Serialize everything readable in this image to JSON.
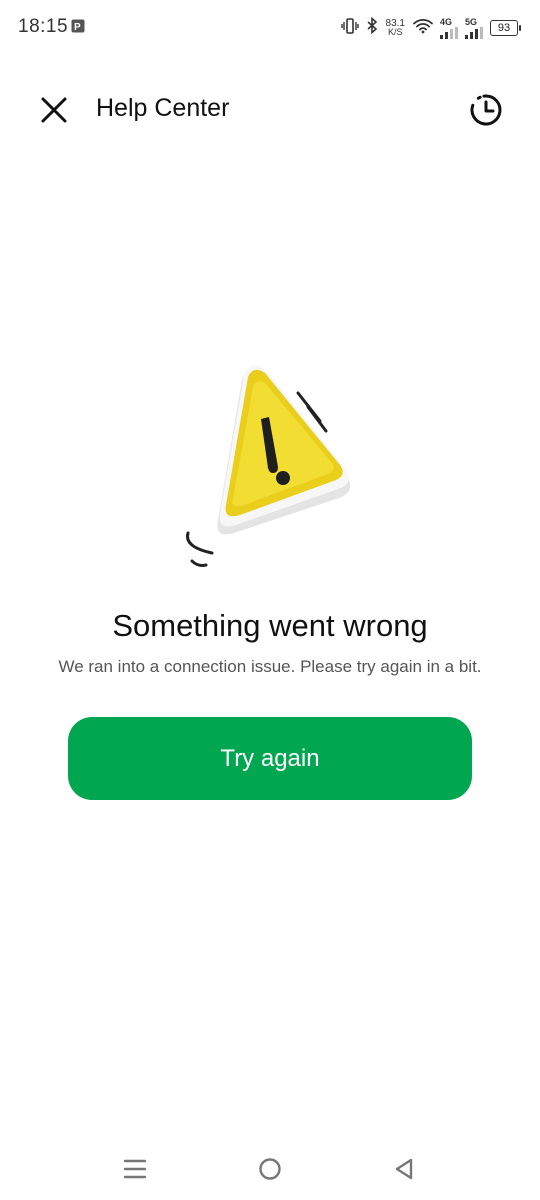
{
  "status_bar": {
    "time": "18:15",
    "net_speed_value": "83.1",
    "net_speed_unit": "K/S",
    "sim1_label": "4G",
    "sim2_label": "5G",
    "battery_level": "93"
  },
  "header": {
    "title": "Help Center"
  },
  "error": {
    "title": "Something went wrong",
    "message": "We ran into a connection issue. Please try again in a bit."
  },
  "retry_button": {
    "label": "Try again"
  },
  "colors": {
    "accent": "#00a650",
    "warning_yellow": "#f2dd32"
  }
}
